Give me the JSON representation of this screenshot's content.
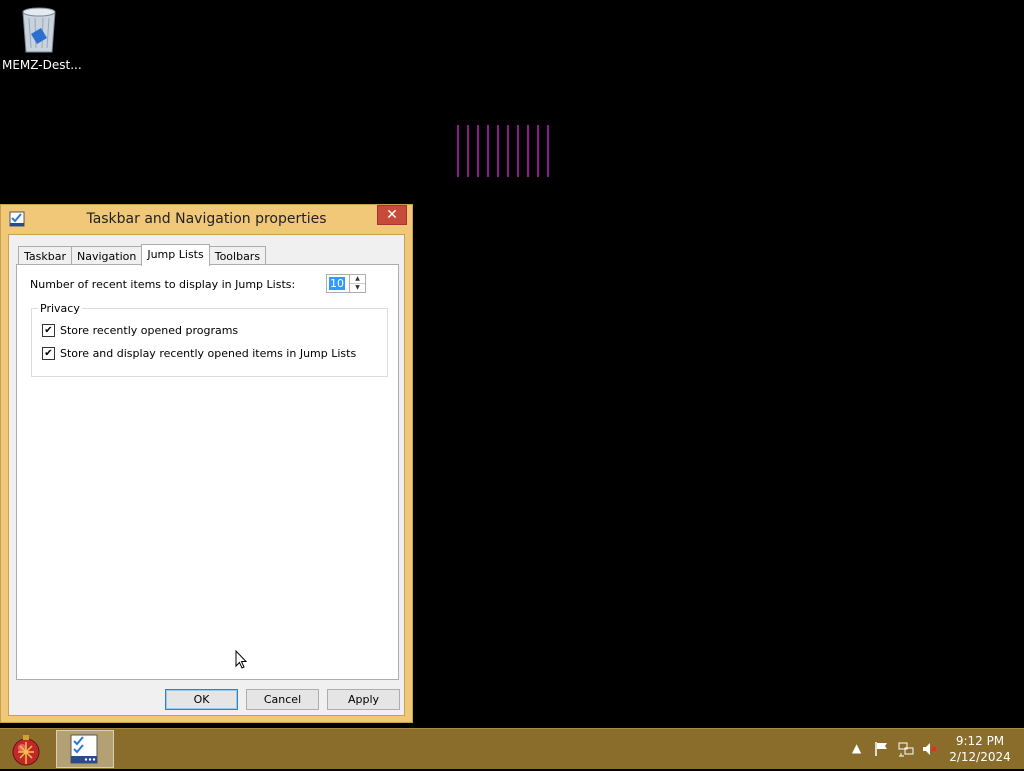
{
  "desktop": {
    "icon_label": "MEMZ-Dest...",
    "icon_name": "recycle-bin-icon"
  },
  "window": {
    "title": "Taskbar and Navigation properties",
    "close_label": "✕",
    "tabs": [
      {
        "label": "Taskbar"
      },
      {
        "label": "Navigation"
      },
      {
        "label": "Jump Lists"
      },
      {
        "label": "Toolbars"
      }
    ],
    "active_tab": "Jump Lists",
    "recent_items_label": "Number of recent items to display in Jump Lists:",
    "recent_items_value": "10",
    "privacy_group": "Privacy",
    "checks": [
      {
        "label": "Store recently opened programs",
        "checked": true
      },
      {
        "label": "Store and display recently opened items in Jump Lists",
        "checked": true
      }
    ],
    "buttons": {
      "ok": "OK",
      "cancel": "Cancel",
      "apply": "Apply"
    }
  },
  "taskbar": {
    "time": "9:12 PM",
    "date": "2/12/2024",
    "tray_icons": [
      "chevron-up-icon",
      "flag-icon",
      "network-icon",
      "speaker-muted-icon"
    ]
  },
  "colors": {
    "window_frame": "#f0c878",
    "taskbar": "#8a6d2a",
    "close_button": "#c74b3a",
    "glitch_lines": "#c020c0"
  }
}
